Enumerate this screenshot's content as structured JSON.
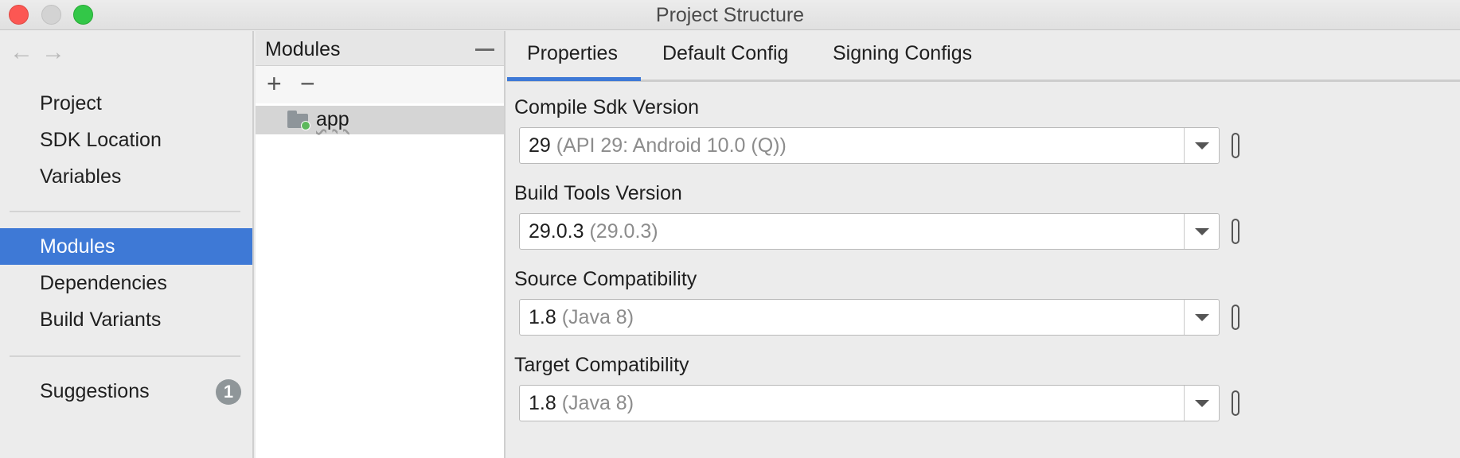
{
  "window": {
    "title": "Project Structure"
  },
  "nav": {
    "back": "←",
    "forward": "→"
  },
  "sidebar": {
    "groups": [
      [
        "Project",
        "SDK Location",
        "Variables"
      ],
      [
        "Modules",
        "Dependencies",
        "Build Variants"
      ]
    ],
    "items": [
      "Project",
      "SDK Location",
      "Variables",
      "Modules",
      "Dependencies",
      "Build Variants",
      "Suggestions"
    ],
    "selected": "Modules",
    "suggestions_badge": "1"
  },
  "modules_panel": {
    "title": "Modules",
    "add_label": "+",
    "remove_label": "−",
    "modules": [
      "app"
    ],
    "selected_module": "app"
  },
  "tabs": {
    "items": [
      "Properties",
      "Default Config",
      "Signing Configs"
    ],
    "active": "Properties"
  },
  "properties": [
    {
      "label": "Compile Sdk Version",
      "value": "29",
      "hint": "(API 29: Android 10.0 (Q))"
    },
    {
      "label": "Build Tools Version",
      "value": "29.0.3",
      "hint": "(29.0.3)"
    },
    {
      "label": "Source Compatibility",
      "value": "1.8",
      "hint": "(Java 8)"
    },
    {
      "label": "Target Compatibility",
      "value": "1.8",
      "hint": "(Java 8)"
    }
  ],
  "colors": {
    "accent": "#3e79d6",
    "close": "#fc5753",
    "maximize": "#33c748"
  }
}
